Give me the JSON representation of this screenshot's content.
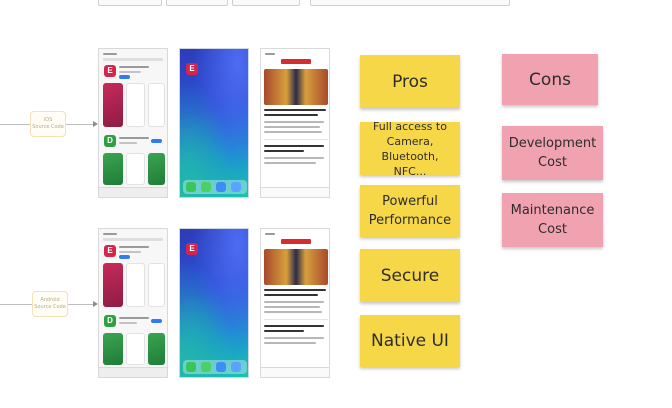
{
  "sources": [
    {
      "name": "iOS",
      "sub": "Source Code"
    },
    {
      "name": "Android",
      "sub": "Source Code"
    }
  ],
  "pros": {
    "header": "Pros",
    "items": [
      "Full access to Camera, Bluetooth, NFC...",
      "Powerful Performance",
      "Secure",
      "Native UI"
    ]
  },
  "cons": {
    "header": "Cons",
    "items": [
      "Development Cost",
      "Maintenance Cost"
    ]
  },
  "colors": {
    "pros_note": "#f6d747",
    "cons_note": "#f0a2b0",
    "app_brand": "#d4264d"
  },
  "icons": [
    "app-logo-icon",
    "home-screen-app-icon",
    "phone-call-icon",
    "camera-icon"
  ]
}
